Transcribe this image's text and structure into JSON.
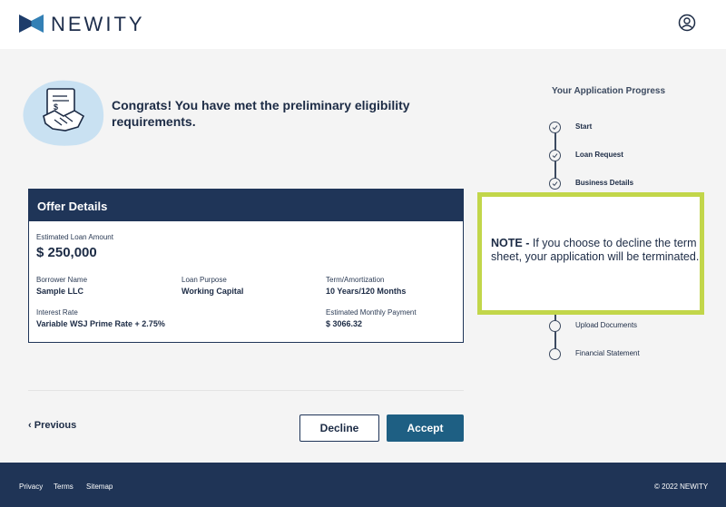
{
  "brand": {
    "name": "NEWITY"
  },
  "hero": {
    "title": "Congrats! You have met the preliminary eligibility requirements."
  },
  "offer": {
    "heading": "Offer Details",
    "amount_label": "Estimated Loan Amount",
    "amount": "$ 250,000",
    "borrower_label": "Borrower Name",
    "borrower": "Sample LLC",
    "purpose_label": "Loan Purpose",
    "purpose": "Working Capital",
    "term_label": "Term/Amortization",
    "term": "10 Years/120 Months",
    "rate_label": "Interest Rate",
    "rate": "Variable WSJ Prime Rate + 2.75%",
    "payment_label": "Estimated Monthly Payment",
    "payment": "$ 3066.32"
  },
  "actions": {
    "previous": "Previous",
    "decline": "Decline",
    "accept": "Accept"
  },
  "progress": {
    "title": "Your Application Progress",
    "steps": [
      {
        "label": "Start",
        "status": "done"
      },
      {
        "label": "Loan Request",
        "status": "done"
      },
      {
        "label": "Business Details",
        "status": "done"
      },
      {
        "label": "Upload Documents",
        "status": "pending"
      },
      {
        "label": "Financial Statement",
        "status": "pending"
      }
    ]
  },
  "note": {
    "prefix": "NOTE - ",
    "text": "If you choose to decline the term sheet, your application will be terminated."
  },
  "footer": {
    "privacy": "Privacy",
    "terms": "Terms",
    "sitemap": "Sitemap",
    "copyright": "© 2022 NEWITY"
  },
  "colors": {
    "navy": "#1f3558",
    "accent_blue": "#1e5f83",
    "note_border": "#c2d64a"
  }
}
